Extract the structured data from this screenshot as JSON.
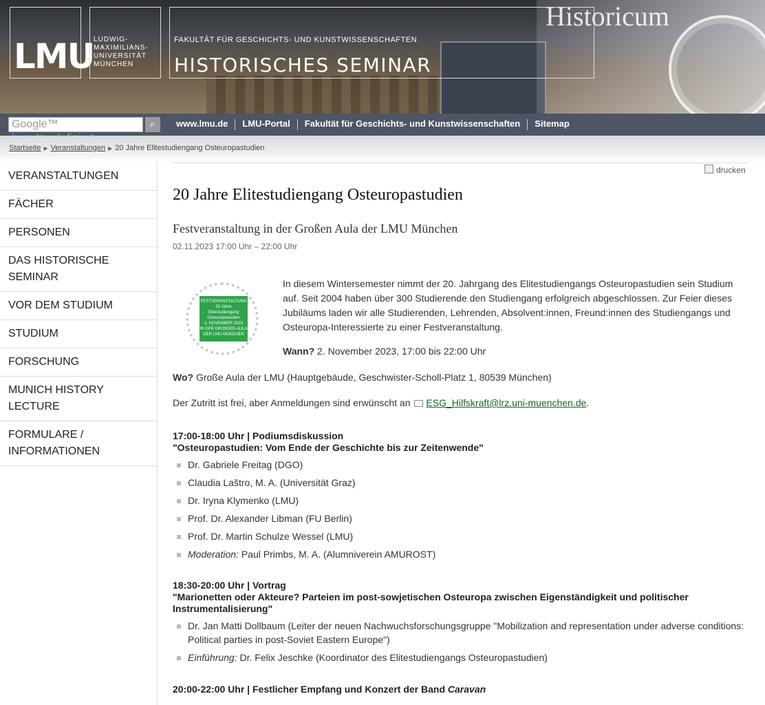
{
  "header": {
    "logo": "LMU",
    "university": "LUDWIG-\nMAXIMILIANS-\nUNIVERSITÄT\nMÜNCHEN",
    "faculty": "FAKULTÄT FÜR GESCHICHTS- UND KUNSTWISSENSCHAFTEN",
    "seminar": "HISTORISCHES SEMINAR",
    "watermark": "Historicum"
  },
  "search": {
    "placeholder": "Google™ benutzerdefiniert"
  },
  "toplinks": [
    "www.lmu.de",
    "LMU-Portal",
    "Fakultät für Geschichts- und Kunstwissenschaften",
    "Sitemap"
  ],
  "breadcrumb": {
    "items": [
      "Startseite",
      "Veranstaltungen"
    ],
    "current": "20 Jahre Elitestudiengang Osteuropastudien"
  },
  "sidebar": {
    "items": [
      "VERANSTALTUNGEN",
      "FÄCHER",
      "PERSONEN",
      "DAS HISTORISCHE SEMINAR",
      "VOR DEM STUDIUM",
      "STUDIUM",
      "FORSCHUNG",
      "MUNICH HISTORY LECTURE",
      "FORMULARE / INFORMATIONEN"
    ]
  },
  "print_label": "drucken",
  "article": {
    "title": "20 Jahre Elitestudiengang Osteuropastudien",
    "subtitle": "Festveranstaltung in der Großen Aula der LMU München",
    "date": "02.11.2023 17:00 Uhr – 22:00 Uhr",
    "logo_lines": [
      "FESTVERANSTALTUNG",
      "20 Jahre",
      "Elitestudiengang",
      "Osteuropastudien",
      "2. NOVEMBER 2023",
      "IN DER GROSSEN AULA",
      "DER LMU MÜNCHEN"
    ],
    "intro": "In diesem Wintersemester nimmt der 20. Jahrgang des Elitestudiengangs Osteuropastudien sein Studium auf. Seit 2004 haben über 300 Studierende den Studiengang erfolgreich abgeschlossen. Zur Feier dieses Jubiläums laden wir alle Studierenden, Lehrenden, Absolvent:innen, Freund:innen des Studiengangs und Osteuropa-Interessierte zu einer Festveranstaltung.",
    "wann_label": "Wann?",
    "wann_value": " 2. November 2023, 17:00 bis 22:00 Uhr",
    "wo_label": "Wo?",
    "wo_value": " Große Aula der LMU (Hauptgebäude, Geschwister-Scholl-Platz 1, 80539 München)",
    "zutritt": "Der Zutritt ist frei, aber Anmeldungen sind erwünscht an",
    "email": "ESG_Hilfskraft@lrz.uni-muenchen.de",
    "email_suffix": ".",
    "sections": [
      {
        "time": "17:00-18:00 Uhr",
        "type": "Podiumsdiskussion",
        "title": "\"Osteuropastudien: Vom Ende der Geschichte bis zur Zeitenwende\"",
        "items": [
          {
            "prefix": "",
            "text": "Dr. Gabriele Freitag (DGO)"
          },
          {
            "prefix": "",
            "text": "Claudia Laštro, M. A. (Universität Graz)"
          },
          {
            "prefix": "",
            "text": "Dr. Iryna Klymenko (LMU)"
          },
          {
            "prefix": "",
            "text": "Prof. Dr. Alexander Libman (FU Berlin)"
          },
          {
            "prefix": "",
            "text": "Prof. Dr. Martin Schulze Wessel (LMU)"
          },
          {
            "prefix": "Moderation:",
            "text": " Paul Primbs, M. A. (Alumniverein AMUROST)"
          }
        ]
      },
      {
        "time": "18:30-20:00 Uhr",
        "type": "Vortrag",
        "title": "\"Marionetten oder Akteure? Parteien im post-sowjetischen Osteuropa zwischen Eigenständigkeit und politischer Instrumentalisierung\"",
        "items": [
          {
            "prefix": "",
            "text": "Dr. Jan Matti Dollbaum (Leiter der neuen Nachwuchsforschungsgruppe \"Mobilization and representation under adverse conditions: Political parties in post-Soviet Eastern Europe\")"
          },
          {
            "prefix": "Einführung:",
            "text": " Dr. Felix Jeschke (Koordinator des Elitestudiengangs Osteuropastudien)"
          }
        ]
      }
    ],
    "final_time": "20:00-22:00 Uhr",
    "final_title": "Festlicher Empfang und Konzert der Band ",
    "final_band": "Caravan"
  }
}
